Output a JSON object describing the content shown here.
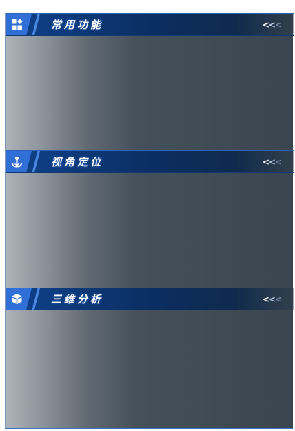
{
  "sections": [
    {
      "title": "常用功能",
      "icon": "apps-grid-icon"
    },
    {
      "title": "视角定位",
      "icon": "location-pin-icon"
    },
    {
      "title": "三维分析",
      "icon": "cube-icon"
    }
  ],
  "collapse_glyph": "<",
  "colors": {
    "accent": "#2f6fd6",
    "header": "#0e3f86",
    "panel_dark": "#3a454f",
    "panel_light": "#aeb3ba"
  }
}
